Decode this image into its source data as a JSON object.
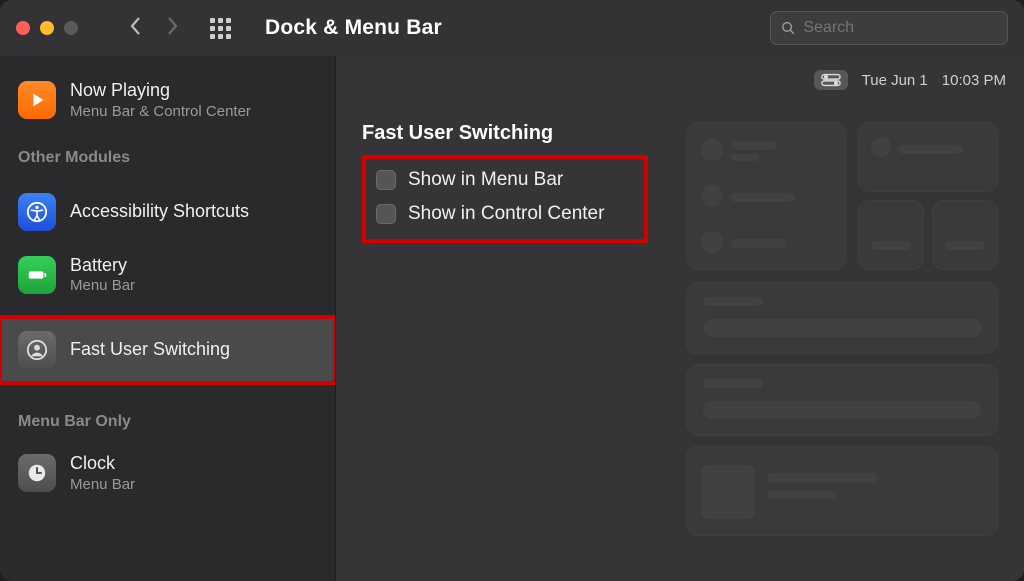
{
  "window": {
    "title": "Dock & Menu Bar",
    "search_placeholder": "Search"
  },
  "menubar": {
    "date": "Tue Jun 1",
    "time": "10:03 PM"
  },
  "sidebar": {
    "items": [
      {
        "name": "Now Playing",
        "sub": "Menu Bar & Control Center",
        "icon": "play"
      }
    ],
    "section_other": "Other Modules",
    "other": [
      {
        "name": "Accessibility Shortcuts",
        "sub": "",
        "icon": "accessibility"
      },
      {
        "name": "Battery",
        "sub": "Menu Bar",
        "icon": "battery"
      },
      {
        "name": "Fast User Switching",
        "sub": "",
        "icon": "user",
        "selected": true
      }
    ],
    "section_mb_only": "Menu Bar Only",
    "mb_only": [
      {
        "name": "Clock",
        "sub": "Menu Bar",
        "icon": "clock"
      }
    ]
  },
  "main": {
    "heading": "Fast User Switching",
    "checks": [
      {
        "label": "Show in Menu Bar",
        "checked": false
      },
      {
        "label": "Show in Control Center",
        "checked": false
      }
    ]
  }
}
